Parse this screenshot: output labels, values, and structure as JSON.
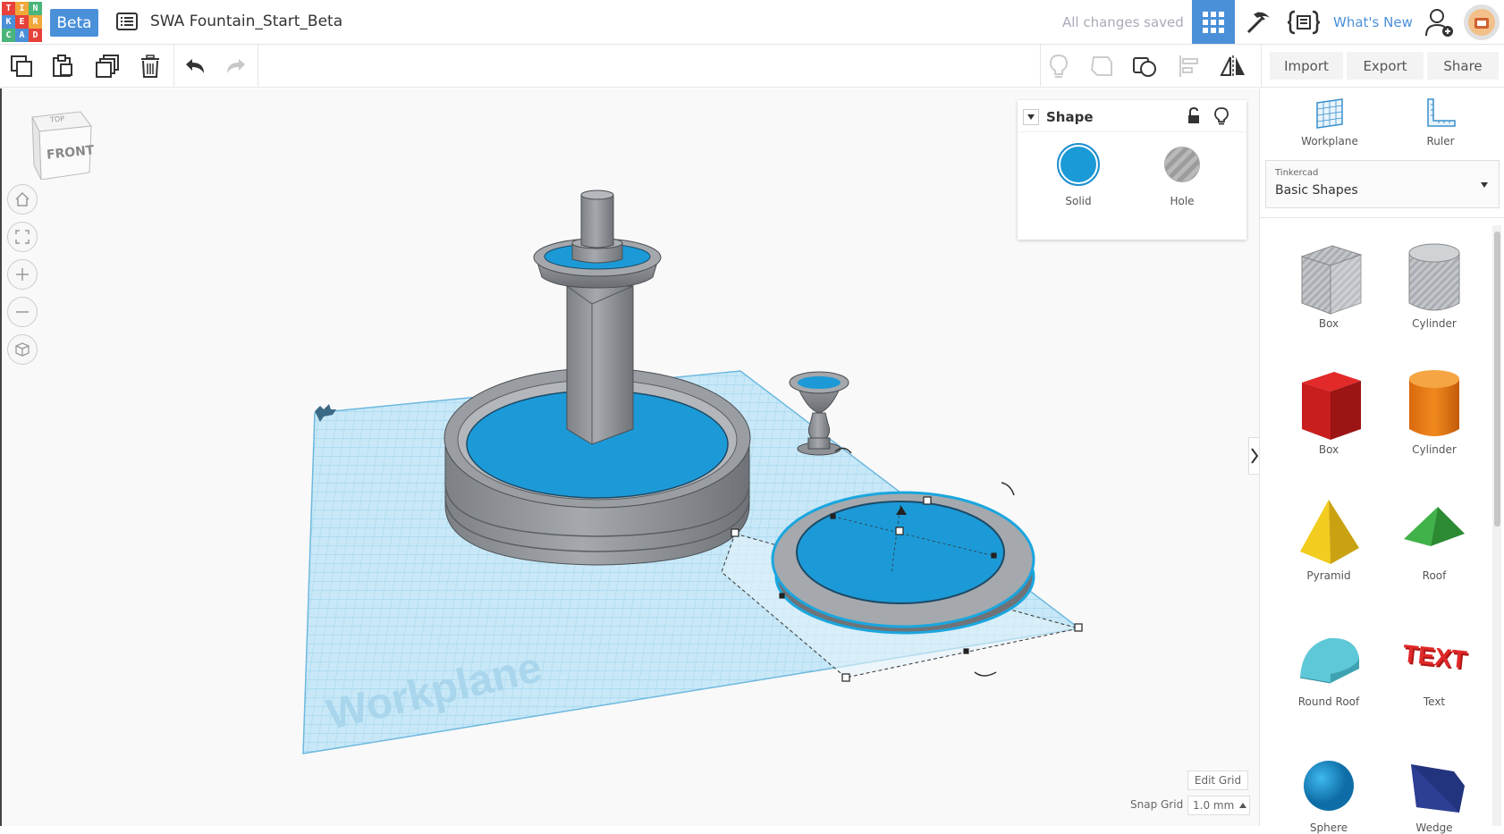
{
  "app": {
    "logo_letters": [
      "T",
      "I",
      "N",
      "K",
      "E",
      "R",
      "C",
      "A",
      "D"
    ],
    "beta_label": "Beta",
    "document_title": "SWA Fountain_Start_Beta",
    "save_status": "All changes saved",
    "whats_new": "What's New"
  },
  "toolbar": {
    "import_label": "Import",
    "export_label": "Export",
    "share_label": "Share"
  },
  "viewcube": {
    "top_label": "TOP",
    "front_label": "FRONT"
  },
  "inspector": {
    "title": "Shape",
    "solid_label": "Solid",
    "hole_label": "Hole"
  },
  "sidebar": {
    "workplane_label": "Workplane",
    "ruler_label": "Ruler",
    "library_caption": "Tinkercad",
    "library_value": "Basic Shapes",
    "shapes": [
      {
        "label": "Box",
        "icon": "box-striped-icon"
      },
      {
        "label": "Cylinder",
        "icon": "cylinder-striped-icon"
      },
      {
        "label": "Box",
        "icon": "box-red-icon"
      },
      {
        "label": "Cylinder",
        "icon": "cylinder-orange-icon"
      },
      {
        "label": "Pyramid",
        "icon": "pyramid-icon"
      },
      {
        "label": "Roof",
        "icon": "roof-icon"
      },
      {
        "label": "Round Roof",
        "icon": "round-roof-icon"
      },
      {
        "label": "Text",
        "icon": "text-3d-icon"
      },
      {
        "label": "Sphere",
        "icon": "sphere-icon"
      },
      {
        "label": "Wedge",
        "icon": "wedge-icon"
      }
    ]
  },
  "workplane": {
    "watermark": "Workplane"
  },
  "grid": {
    "edit_grid_label": "Edit Grid",
    "snap_grid_label": "Snap Grid",
    "snap_value": "1.0 mm"
  },
  "colors": {
    "accent": "#4a90d9",
    "water": "#1a9ad6",
    "stone": "#8c9196",
    "workplane": "#bfe3f5"
  }
}
